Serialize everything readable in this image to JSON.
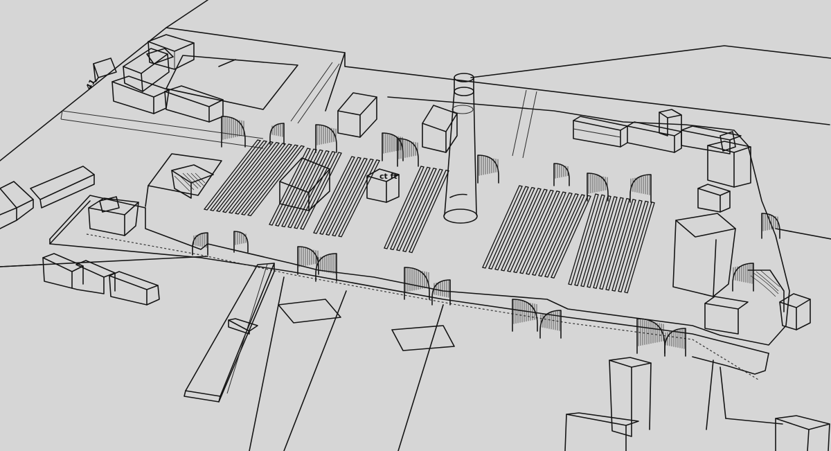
{
  "viewport": {
    "background": "#d6d6d6",
    "line_color": "#141414"
  },
  "labels": {
    "corner_mark": "41",
    "center_mark": "ct ft"
  }
}
